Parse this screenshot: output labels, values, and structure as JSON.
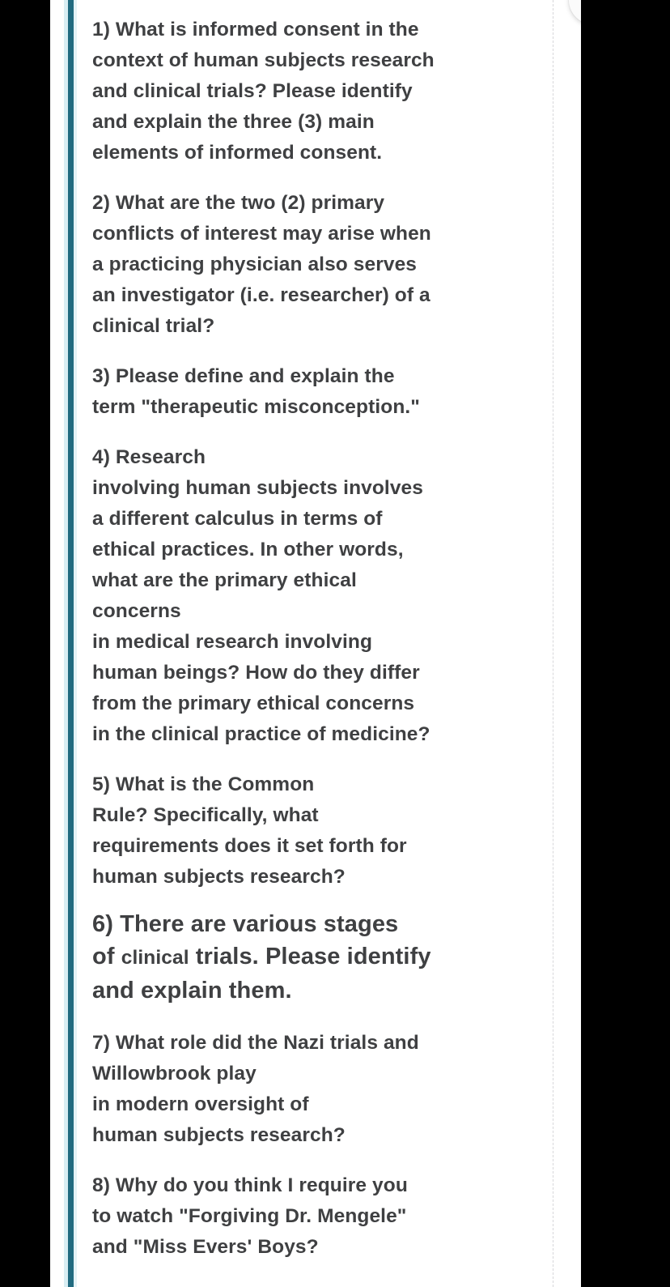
{
  "page": {
    "accent_color": "#216b80",
    "text_color": "#3f4042",
    "background_color": "#ffffff",
    "letterbox_color": "#000000"
  },
  "controls": {
    "next_button": {
      "icon": "chevron-right-icon",
      "label": ""
    }
  },
  "questions": [
    {
      "id": "q1",
      "number": "1)",
      "text": "1) What is informed consent in the\ncontext of human subjects research\nand clinical trials? Please identify\nand explain the three (3) main\nelements of informed consent."
    },
    {
      "id": "q2",
      "number": "2)",
      "text": "2) What are the two (2) primary\nconflicts of interest may arise when\na practicing physician also serves\nan investigator (i.e. researcher) of a\nclinical trial?"
    },
    {
      "id": "q3",
      "number": "3)",
      "text": "3) Please define and explain the\nterm \"therapeutic misconception.\""
    },
    {
      "id": "q4",
      "number": "4)",
      "text": "4) Research\ninvolving human subjects involves\na different calculus in terms of\nethical practices. In other words,\nwhat are the primary ethical\nconcerns\nin medical research involving\nhuman beings? How do they differ\nfrom the primary ethical concerns\nin the clinical practice of medicine?"
    },
    {
      "id": "q5",
      "number": "5)",
      "text": "5) What is the Common\nRule? Specifically, what\nrequirements does it set forth for\nhuman subjects research?"
    },
    {
      "id": "q6",
      "number": "6)",
      "text_before": "6) There are various stages\nof ",
      "text_small": "clinical",
      "text_after": " trials. Please identify\nand explain them."
    },
    {
      "id": "q7",
      "number": "7)",
      "text": "7) What role did the Nazi trials and\nWillowbrook play\nin modern oversight of\nhuman subjects research?"
    },
    {
      "id": "q8",
      "number": "8)",
      "text": "8) Why do you think I require you\nto watch \"Forgiving Dr. Mengele\"\nand \"Miss Evers' Boys?"
    }
  ]
}
